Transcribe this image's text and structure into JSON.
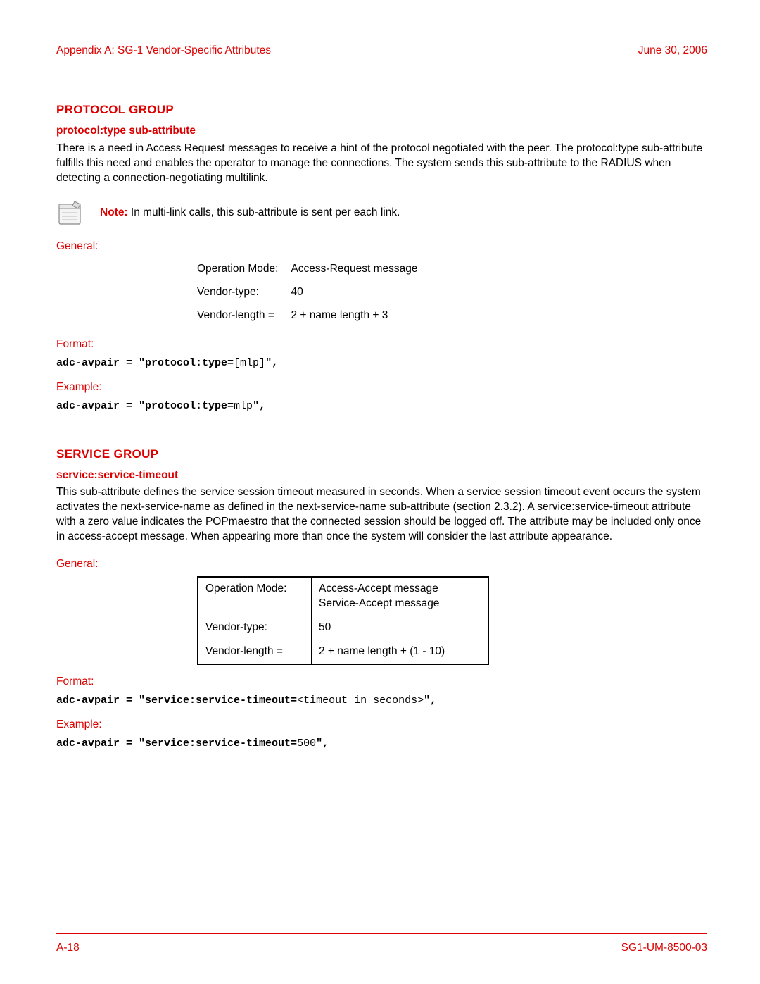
{
  "header": {
    "left": "Appendix A: SG-1 Vendor-Specific Attributes",
    "right": "June 30, 2006"
  },
  "footer": {
    "left": "A-18",
    "right": "SG1-UM-8500-03"
  },
  "protocol": {
    "title": "PROTOCOL GROUP",
    "sub": "protocol:type sub-attribute",
    "body": "There is a need in Access Request messages to receive a hint of the protocol negotiated with the peer. The protocol:type sub-attribute fulfills this need and enables the operator to manage the connections. The system sends this sub-attribute to the RADIUS when detecting a connection-negotiating multilink.",
    "note_label": "Note:",
    "note_text": " In multi-link calls, this sub-attribute is sent per each link.",
    "general_label": "General:",
    "table": {
      "r1k": "Operation Mode:",
      "r1v": "Access-Request message",
      "r2k": "Vendor-type:",
      "r2v": "40",
      "r3k": "Vendor-length =",
      "r3v": "2 + name length + 3"
    },
    "format_label": "Format:",
    "format_prefix": "adc-avpair = \"protocol:type=",
    "format_var": "[mlp]",
    "format_suffix": "\",",
    "example_label": "Example:",
    "example_prefix": "adc-avpair = \"protocol:type=",
    "example_var": "mlp",
    "example_suffix": "\","
  },
  "service": {
    "title": "SERVICE GROUP",
    "sub": "service:service-timeout",
    "body": "This sub-attribute defines the service session timeout measured in seconds. When a service session timeout event occurs the system activates the next-service-name as defined in the next-service-name sub-attribute (section 2.3.2). A service:service-timeout attribute with a zero value indicates the POPmaestro that the connected session should be logged off. The attribute may be included only once in access-accept message. When appearing more than once the system will consider the last attribute appearance.",
    "general_label": "General:",
    "table": {
      "r1k": "Operation Mode:",
      "r1v1": "Access-Accept message",
      "r1v2": "Service-Accept message",
      "r2k": "Vendor-type:",
      "r2v": "50",
      "r3k": "Vendor-length =",
      "r3v": "2 + name length + (1 - 10)"
    },
    "format_label": "Format:",
    "format_prefix": "adc-avpair = \"service:service-timeout=",
    "format_var": "<timeout in seconds>",
    "format_suffix": "\",",
    "example_label": "Example:",
    "example_prefix": "adc-avpair = \"service:service-timeout=",
    "example_var": "500",
    "example_suffix": "\","
  }
}
